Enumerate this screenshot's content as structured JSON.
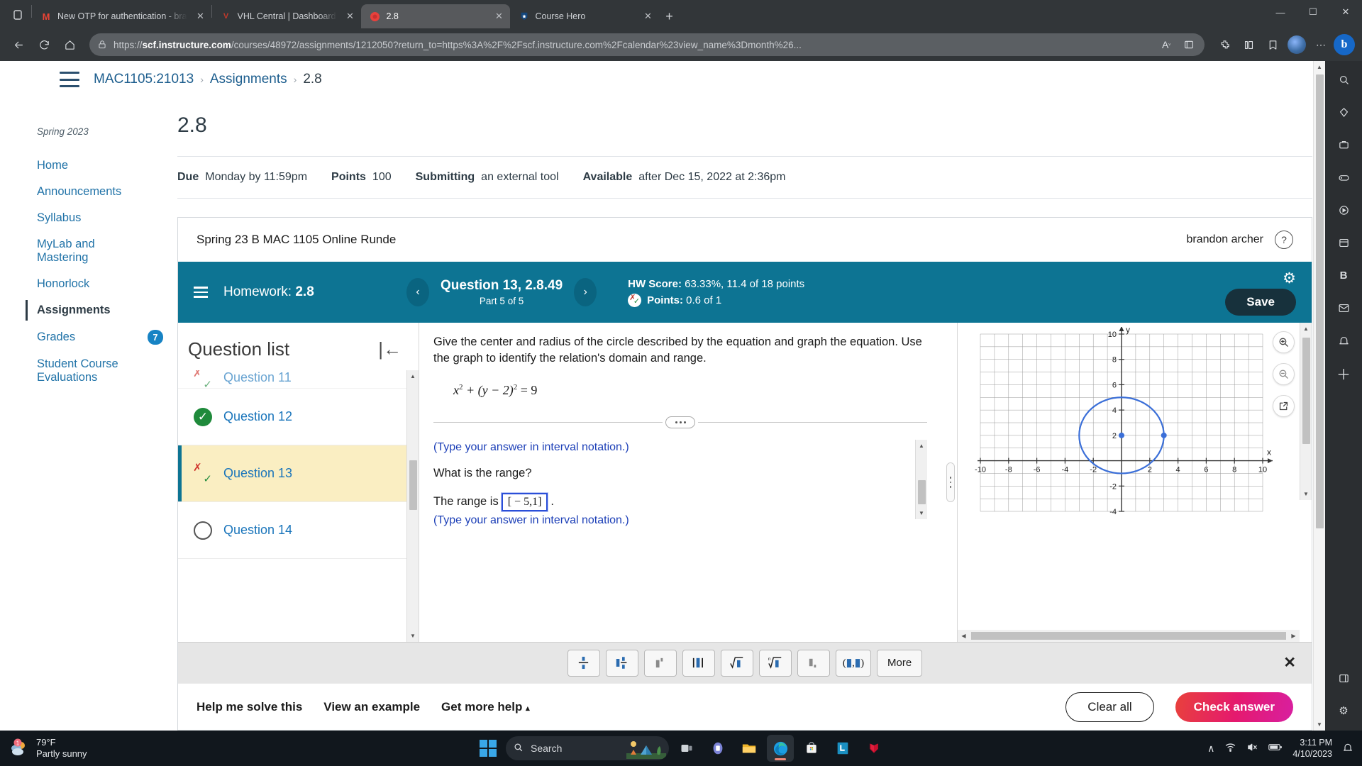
{
  "browser": {
    "tabs": [
      {
        "title": "New OTP for authentication - bra",
        "favicon": "gmail-icon",
        "active": false
      },
      {
        "title": "VHL Central | Dashboard",
        "favicon": "vhl-icon",
        "active": false
      },
      {
        "title": "2.8",
        "favicon": "pearson-icon",
        "active": true
      },
      {
        "title": "Course Hero",
        "favicon": "coursehero-icon",
        "active": false
      }
    ],
    "url_host": "scf.instructure.com",
    "url_rest": "/courses/48972/assignments/1212050?return_to=https%3A%2F%2Fscf.instructure.com%2Fcalendar%23view_name%3Dmonth%26...",
    "url_prefix": "https://",
    "new_tab_label": "+",
    "window_controls": {
      "minimize": "—",
      "maximize": "☐",
      "close": "✕"
    }
  },
  "canvas": {
    "breadcrumb": [
      {
        "label": "MAC1105:21013",
        "current": false
      },
      {
        "label": "Assignments",
        "current": false
      },
      {
        "label": "2.8",
        "current": true
      }
    ],
    "term": "Spring 2023",
    "nav_items": [
      {
        "label": "Home",
        "active": false,
        "badge": ""
      },
      {
        "label": "Announcements",
        "active": false,
        "badge": ""
      },
      {
        "label": "Syllabus",
        "active": false,
        "badge": ""
      },
      {
        "label": "MyLab and Mastering",
        "active": false,
        "badge": ""
      },
      {
        "label": "Honorlock",
        "active": false,
        "badge": ""
      },
      {
        "label": "Assignments",
        "active": true,
        "badge": ""
      },
      {
        "label": "Grades",
        "active": false,
        "badge": "7"
      },
      {
        "label": "Student Course Evaluations",
        "active": false,
        "badge": ""
      }
    ],
    "assignment_title": "2.8",
    "meta": [
      {
        "label": "Due",
        "value": "Monday by 11:59pm"
      },
      {
        "label": "Points",
        "value": "100"
      },
      {
        "label": "Submitting",
        "value": "an external tool"
      },
      {
        "label": "Available",
        "value": "after Dec 15, 2022 at 2:36pm"
      }
    ]
  },
  "mylab": {
    "course_name": "Spring 23 B MAC 1105 Online Runde",
    "user_name": "brandon archer",
    "help_icon": "question-mark-icon",
    "homework_label": "Homework:",
    "homework_value": "2.8",
    "prev_label": "‹",
    "next_label": "›",
    "question_id": "Question 13, 2.8.49",
    "part_label": "Part 5 of 5",
    "hw_score_label": "HW Score:",
    "hw_score_value": "63.33%, 11.4 of 18 points",
    "points_label": "Points:",
    "points_value": "0.6 of 1",
    "save_label": "Save",
    "settings_icon": "gear-icon",
    "question_list": {
      "title": "Question list",
      "collapse_icon": "collapse-left-icon",
      "items": [
        {
          "label": "Question 11",
          "status": "partial",
          "selected": false,
          "clipped": true
        },
        {
          "label": "Question 12",
          "status": "correct",
          "selected": false,
          "clipped": false
        },
        {
          "label": "Question 13",
          "status": "partial",
          "selected": true,
          "clipped": false
        },
        {
          "label": "Question 14",
          "status": "unanswered",
          "selected": false,
          "clipped": false
        }
      ]
    },
    "question": {
      "stem": "Give the center and radius of the circle described by the equation and graph the equation. Use the graph to identify the relation's domain and range.",
      "equation_parts": {
        "x": "x",
        "sup1": "2",
        "mid": " + (y − 2)",
        "sup2": "2",
        "tail": " = 9"
      },
      "hint_top": "(Type your answer in interval notation.)",
      "ask": "What is the range?",
      "answer_prefix": "The range is",
      "answer_value": "[ − 5,1]",
      "answer_suffix": ".",
      "hint_bottom": "(Type your answer in interval notation.)"
    },
    "math_toolbar": {
      "buttons": [
        {
          "name": "fraction-button",
          "label": "fraction"
        },
        {
          "name": "mixed-number-button",
          "label": "mixed"
        },
        {
          "name": "exponent-button",
          "label": "exponent"
        },
        {
          "name": "absolute-value-button",
          "label": "absolute"
        },
        {
          "name": "square-root-button",
          "label": "sqrt"
        },
        {
          "name": "nth-root-button",
          "label": "nthroot"
        },
        {
          "name": "subscript-button",
          "label": "subscript"
        },
        {
          "name": "interval-button",
          "label": "interval"
        }
      ],
      "more_label": "More",
      "close_icon": "close-icon"
    },
    "footer": {
      "help_me_solve": "Help me solve this",
      "view_example": "View an example",
      "get_more_help": "Get more help",
      "get_more_help_caret": "▴",
      "clear_all": "Clear all",
      "check_answer": "Check answer"
    },
    "graph_tools": [
      {
        "name": "zoom-in-icon"
      },
      {
        "name": "zoom-out-icon"
      },
      {
        "name": "open-in-new-window-icon"
      }
    ]
  },
  "chart_data": {
    "type": "scatter",
    "title": "",
    "xlabel": "x",
    "ylabel": "y",
    "xlim": [
      -10,
      10
    ],
    "ylim": [
      -4,
      10
    ],
    "xticks": [
      -10,
      -8,
      -6,
      -4,
      -2,
      2,
      4,
      6,
      8,
      10
    ],
    "yticks": [
      -4,
      -2,
      2,
      4,
      6,
      8,
      10
    ],
    "grid": true,
    "grid_step": 1,
    "curve": {
      "type": "circle",
      "center": [
        0,
        2
      ],
      "radius": 3,
      "color": "#3b6fd8"
    },
    "points": [
      {
        "x": 0,
        "y": 2,
        "label": "center",
        "color": "#3b6fd8"
      },
      {
        "x": 3,
        "y": 2,
        "label": "radius-handle",
        "color": "#3b6fd8"
      }
    ]
  },
  "taskbar": {
    "weather_temp": "79°F",
    "weather_desc": "Partly sunny",
    "weather_badge": "1",
    "search_placeholder": "Search",
    "search_icon": "search-icon",
    "start_icon": "windows-start-icon",
    "apps": [
      {
        "name": "task-view-icon"
      },
      {
        "name": "teams-icon"
      },
      {
        "name": "file-explorer-icon"
      },
      {
        "name": "edge-icon",
        "active": true
      },
      {
        "name": "microsoft-store-icon"
      },
      {
        "name": "lockdown-browser-icon"
      },
      {
        "name": "mcafee-icon"
      }
    ],
    "tray": [
      {
        "name": "show-hidden-icons",
        "glyph": "∧"
      },
      {
        "name": "wifi-icon",
        "glyph": "◠"
      },
      {
        "name": "volume-muted-icon",
        "glyph": "🔇"
      },
      {
        "name": "battery-icon",
        "glyph": "▣"
      }
    ],
    "time": "3:11 PM",
    "date": "4/10/2023"
  },
  "colors": {
    "teal": "#0d7493",
    "canvas_link": "#2173a8",
    "highlight": "#faeec2",
    "check_answer": "#e5196e",
    "graph_blue": "#3b6fd8"
  }
}
